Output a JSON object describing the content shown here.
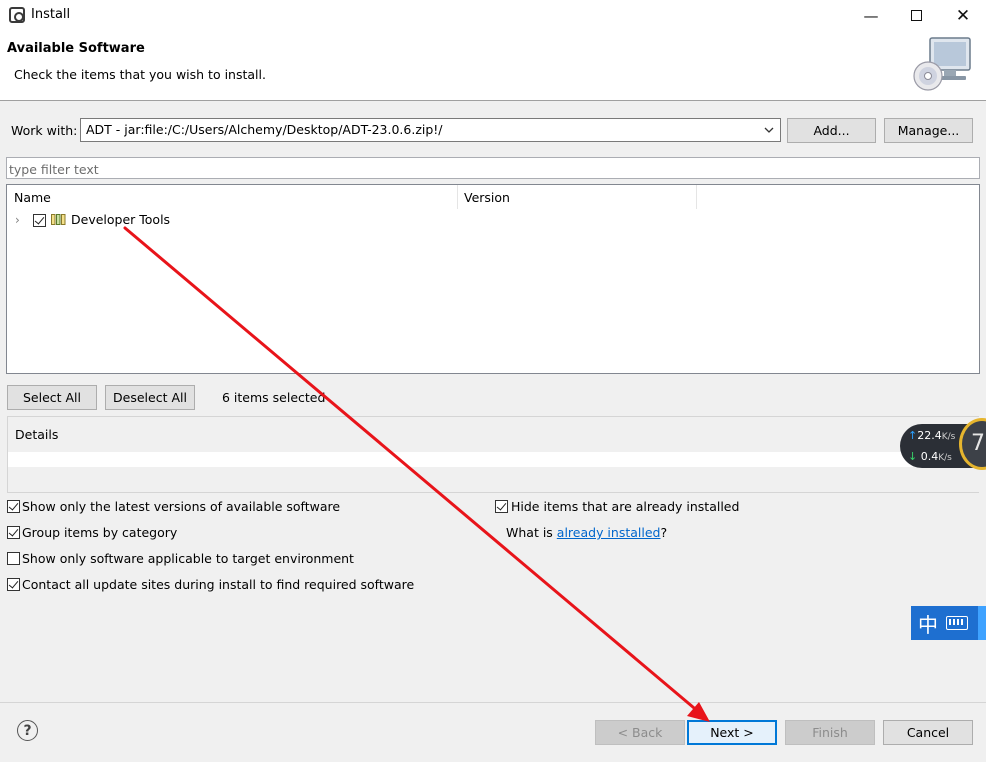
{
  "window": {
    "title": "Install",
    "close_symbol": "✕",
    "minimize_symbol": "—"
  },
  "banner": {
    "title": "Available Software",
    "description": "Check the items that you wish to install."
  },
  "work_with": {
    "label": "Work with:",
    "value": "ADT - jar:file:/C:/Users/Alchemy/Desktop/ADT-23.0.6.zip!/",
    "add_label": "Add...",
    "manage_label": "Manage..."
  },
  "filter": {
    "placeholder": "type filter text"
  },
  "tree": {
    "columns": [
      "Name",
      "Version"
    ],
    "items": [
      {
        "label": "Developer Tools",
        "checked": true,
        "expander": "›"
      }
    ]
  },
  "selection": {
    "select_all_label": "Select All",
    "deselect_all_label": "Deselect All",
    "count_text": "6 items selected"
  },
  "details": {
    "label": "Details"
  },
  "options": {
    "latest_versions": {
      "label": "Show only the latest versions of available software",
      "checked": true
    },
    "group_by_category": {
      "label": "Group items by category",
      "checked": true
    },
    "target_environment": {
      "label": "Show only software applicable to target environment",
      "checked": false
    },
    "contact_sites": {
      "label": "Contact all update sites during install to find required software",
      "checked": true
    },
    "hide_installed": {
      "label": "Hide items that are already installed",
      "checked": true
    },
    "what_is_prefix": "What is ",
    "what_is_link": "already installed",
    "what_is_suffix": "?"
  },
  "footer": {
    "help_symbol": "?",
    "back_label": "< Back",
    "next_label": "Next >",
    "finish_label": "Finish",
    "cancel_label": "Cancel"
  },
  "overlays": {
    "upload_arrow": "↑",
    "upload_speed": "22.4",
    "download_arrow": "↓",
    "download_speed": "0.4",
    "speed_unit": "K/s",
    "ball_number": "7",
    "ime_char": "中"
  },
  "colors": {
    "accent": "#0078d7",
    "annotation_arrow": "#e8141a",
    "link": "#0066cc"
  }
}
